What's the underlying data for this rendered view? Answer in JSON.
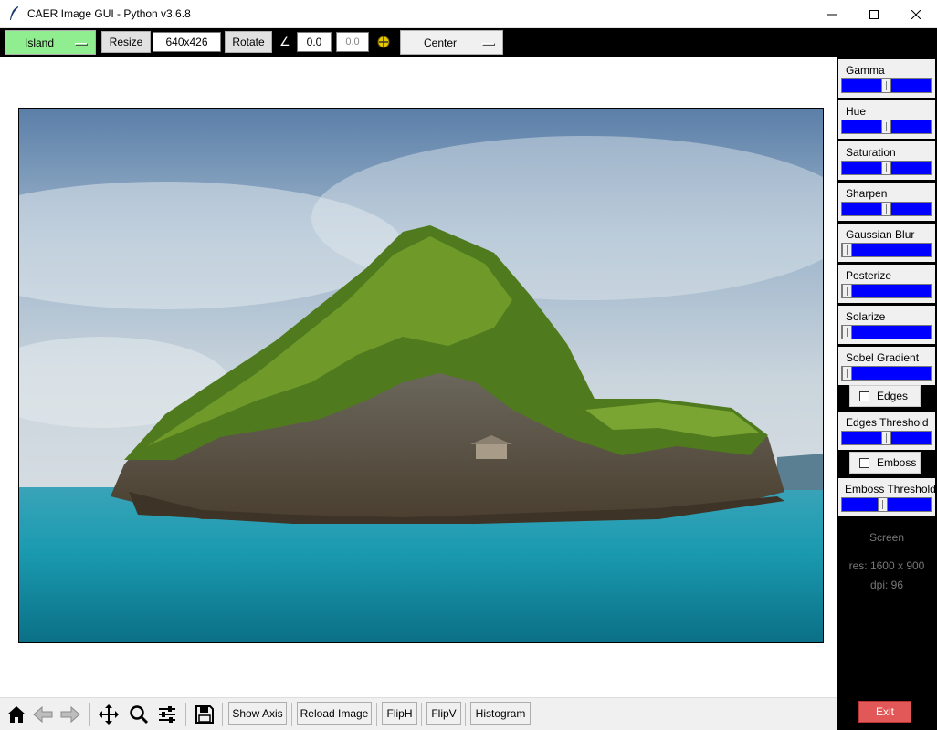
{
  "window": {
    "title": "CAER Image GUI - Python v3.6.8"
  },
  "toolbar": {
    "image_select": "Island",
    "resize_label": "Resize",
    "size_value": "640x426",
    "rotate_label": "Rotate",
    "angle_symbol": "∠",
    "angle_value": "0.0",
    "angle_value2": "0.0",
    "anchor_select": "Center"
  },
  "sliders": [
    {
      "label": "Gamma",
      "value": 0.5
    },
    {
      "label": "Hue",
      "value": 0.5
    },
    {
      "label": "Saturation",
      "value": 0.5
    },
    {
      "label": "Sharpen",
      "value": 0.5
    },
    {
      "label": "Gaussian Blur",
      "value": 0.0
    },
    {
      "label": "Posterize",
      "value": 0.0
    },
    {
      "label": "Solarize",
      "value": 0.0
    },
    {
      "label": "Sobel Gradient",
      "value": 0.0
    }
  ],
  "edges": {
    "checkbox_label": "Edges",
    "checked": false,
    "threshold_label": "Edges Threshold",
    "threshold_value": 0.5
  },
  "emboss": {
    "checkbox_label": "Emboss",
    "checked": false,
    "threshold_label": "Emboss Threshold",
    "threshold_value": 0.45
  },
  "screen": {
    "title": "Screen",
    "res": "res: 1600 x 900",
    "dpi": "dpi: 96"
  },
  "exit_label": "Exit",
  "bottom": {
    "icons": [
      "home-icon",
      "back-arrow-icon",
      "forward-arrow-icon",
      "pan-icon",
      "zoom-icon",
      "configure-subplots-icon",
      "save-icon"
    ],
    "show_axis": "Show Axis",
    "reload_image": "Reload Image",
    "flip_h": "FlipH",
    "flip_v": "FlipV",
    "histogram": "Histogram"
  },
  "colors": {
    "slider_trough": "#0000ff",
    "image_select_bg": "#90ee90",
    "exit_bg": "#e25858"
  }
}
